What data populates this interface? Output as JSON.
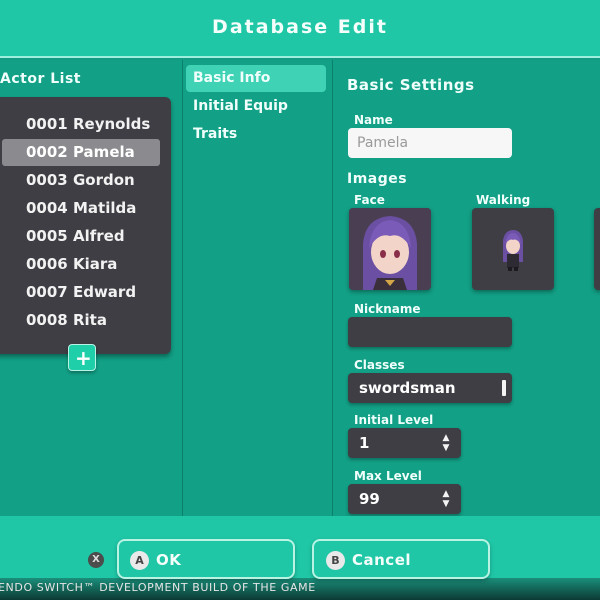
{
  "header": {
    "title": "Database Edit"
  },
  "actor_list": {
    "heading": "Actor List",
    "items": [
      {
        "label": "0001 Reynolds",
        "selected": false
      },
      {
        "label": "0002 Pamela",
        "selected": true
      },
      {
        "label": "0003 Gordon",
        "selected": false
      },
      {
        "label": "0004 Matilda",
        "selected": false
      },
      {
        "label": "0005 Alfred",
        "selected": false
      },
      {
        "label": "0006 Kiara",
        "selected": false
      },
      {
        "label": "0007 Edward",
        "selected": false
      },
      {
        "label": "0008 Rita",
        "selected": false
      }
    ],
    "add_icon": "plus-icon"
  },
  "tabs": [
    {
      "label": "Basic Info",
      "selected": true
    },
    {
      "label": "Initial Equip",
      "selected": false
    },
    {
      "label": "Traits",
      "selected": false
    }
  ],
  "basic_settings": {
    "heading": "Basic Settings",
    "name_label": "Name",
    "name_placeholder": "Pamela",
    "images_heading": "Images",
    "face_label": "Face",
    "walking_label": "Walking Character",
    "nickname_label": "Nickname",
    "nickname_value": "",
    "classes_label": "Classes",
    "classes_value": "swordsman",
    "initial_level_label": "Initial Level",
    "initial_level_value": "1",
    "max_level_label": "Max Level",
    "max_level_value": "99"
  },
  "footer": {
    "x_glyph": "X",
    "ok_glyph": "A",
    "ok_label": "OK",
    "cancel_glyph": "B",
    "cancel_label": "Cancel",
    "watermark": "ENDO SWITCH™ DEVELOPMENT BUILD OF THE GAME"
  },
  "colors": {
    "accent": "#1fc7a6",
    "background": "#139c84",
    "panel": "#3e3e44",
    "selected_item": "#8a8a8f",
    "selected_tab": "#3fd2b5"
  }
}
